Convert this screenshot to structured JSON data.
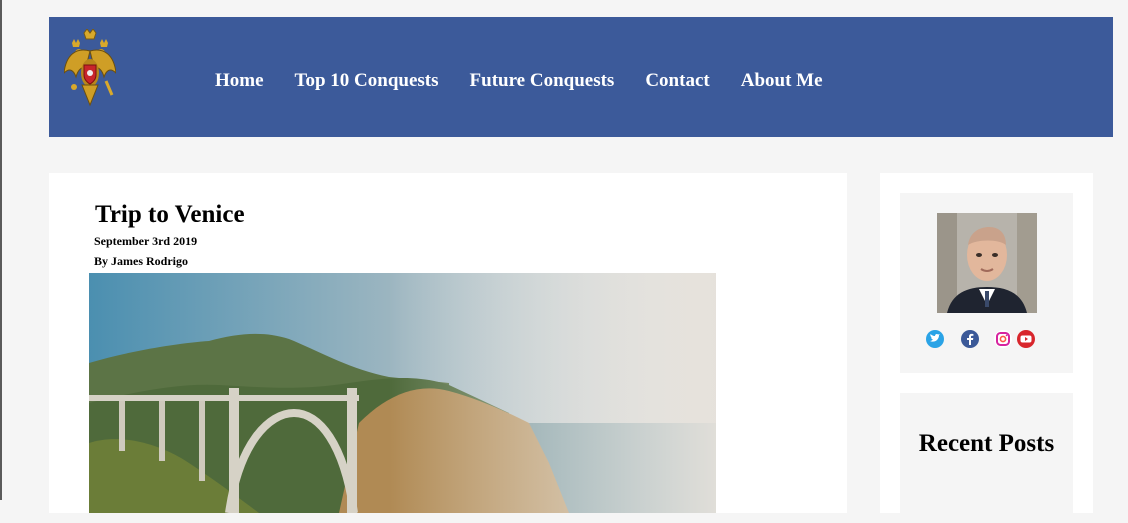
{
  "header": {
    "logo_icon": "double-headed-eagle-emblem",
    "nav": [
      "Home",
      "Top 10 Conquests",
      "Future Conquests",
      "Contact",
      "About Me"
    ],
    "background_color": "#3c5a9a"
  },
  "post": {
    "title": "Trip to Venice",
    "date": "September 3rd 2019",
    "author": "By James Rodrigo",
    "image_icon": "coastal-bridge-photo"
  },
  "sidebar": {
    "profile_icon": "profile-photo",
    "social_icons": [
      "twitter-icon",
      "facebook-icon",
      "instagram-icon",
      "youtube-icon"
    ],
    "recent_title": "Recent Posts"
  }
}
